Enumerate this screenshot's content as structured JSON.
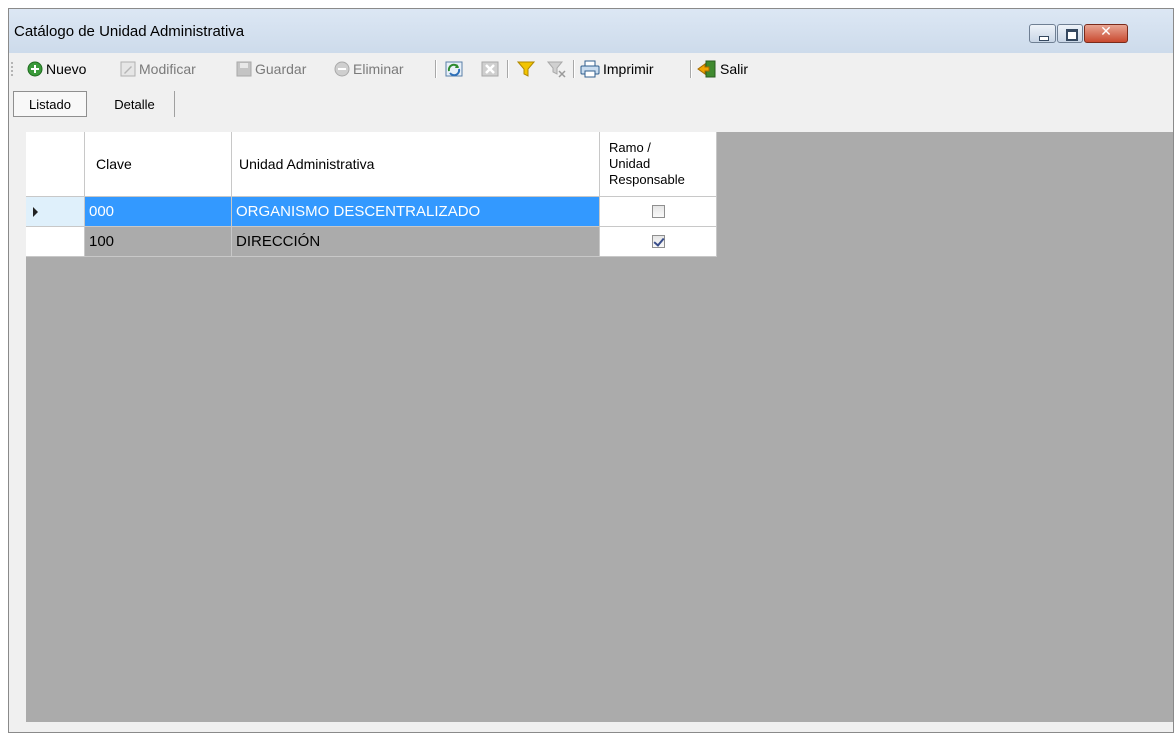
{
  "window": {
    "title": "Catálogo de Unidad Administrativa"
  },
  "toolbar": {
    "nuevo": "Nuevo",
    "modificar": "Modificar",
    "guardar": "Guardar",
    "eliminar": "Eliminar",
    "imprimir": "Imprimir",
    "salir": "Salir"
  },
  "tabs": {
    "listado": "Listado",
    "detalle": "Detalle"
  },
  "grid": {
    "columns": {
      "clave": "Clave",
      "unidad": "Unidad Administrativa",
      "ramo_line1": "Ramo /",
      "ramo_line2": "Unidad",
      "ramo_line3": "Responsable"
    },
    "rows": [
      {
        "clave": "000",
        "unidad": "ORGANISMO DESCENTRALIZADO",
        "ramo_unidad_responsable": false,
        "selected": true
      },
      {
        "clave": "100",
        "unidad": "DIRECCIÓN",
        "ramo_unidad_responsable": true,
        "selected": false
      }
    ]
  },
  "colors": {
    "selection": "#3399ff",
    "grid_background": "#ababab",
    "titlebar": "#dce7f4"
  }
}
